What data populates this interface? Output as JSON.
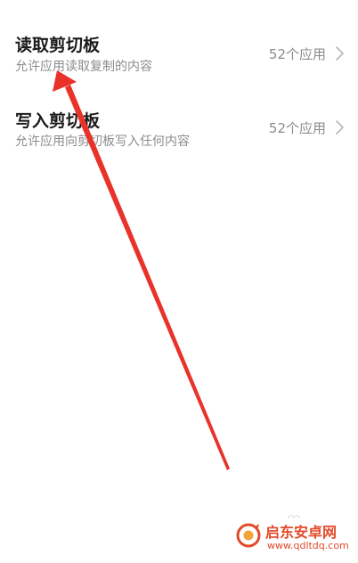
{
  "settings": {
    "rows": [
      {
        "title": "读取剪切板",
        "description": "允许应用读取复制的内容",
        "value": "52个应用"
      },
      {
        "title": "写入剪切板",
        "description": "允许应用向剪切板写入任何内容",
        "value": "52个应用"
      }
    ]
  },
  "annotation": {
    "arrow_color": "#e8322a"
  },
  "watermark": {
    "name": "启东安卓网",
    "url": "www.qdltdq.com",
    "color": "#e24a2a"
  },
  "colors": {
    "title": "#1a1a1a",
    "secondary": "#8c8c8c",
    "background": "#ffffff"
  },
  "icons": {
    "chevron": "chevron-right-icon",
    "watermark_logo": "site-logo-icon"
  }
}
